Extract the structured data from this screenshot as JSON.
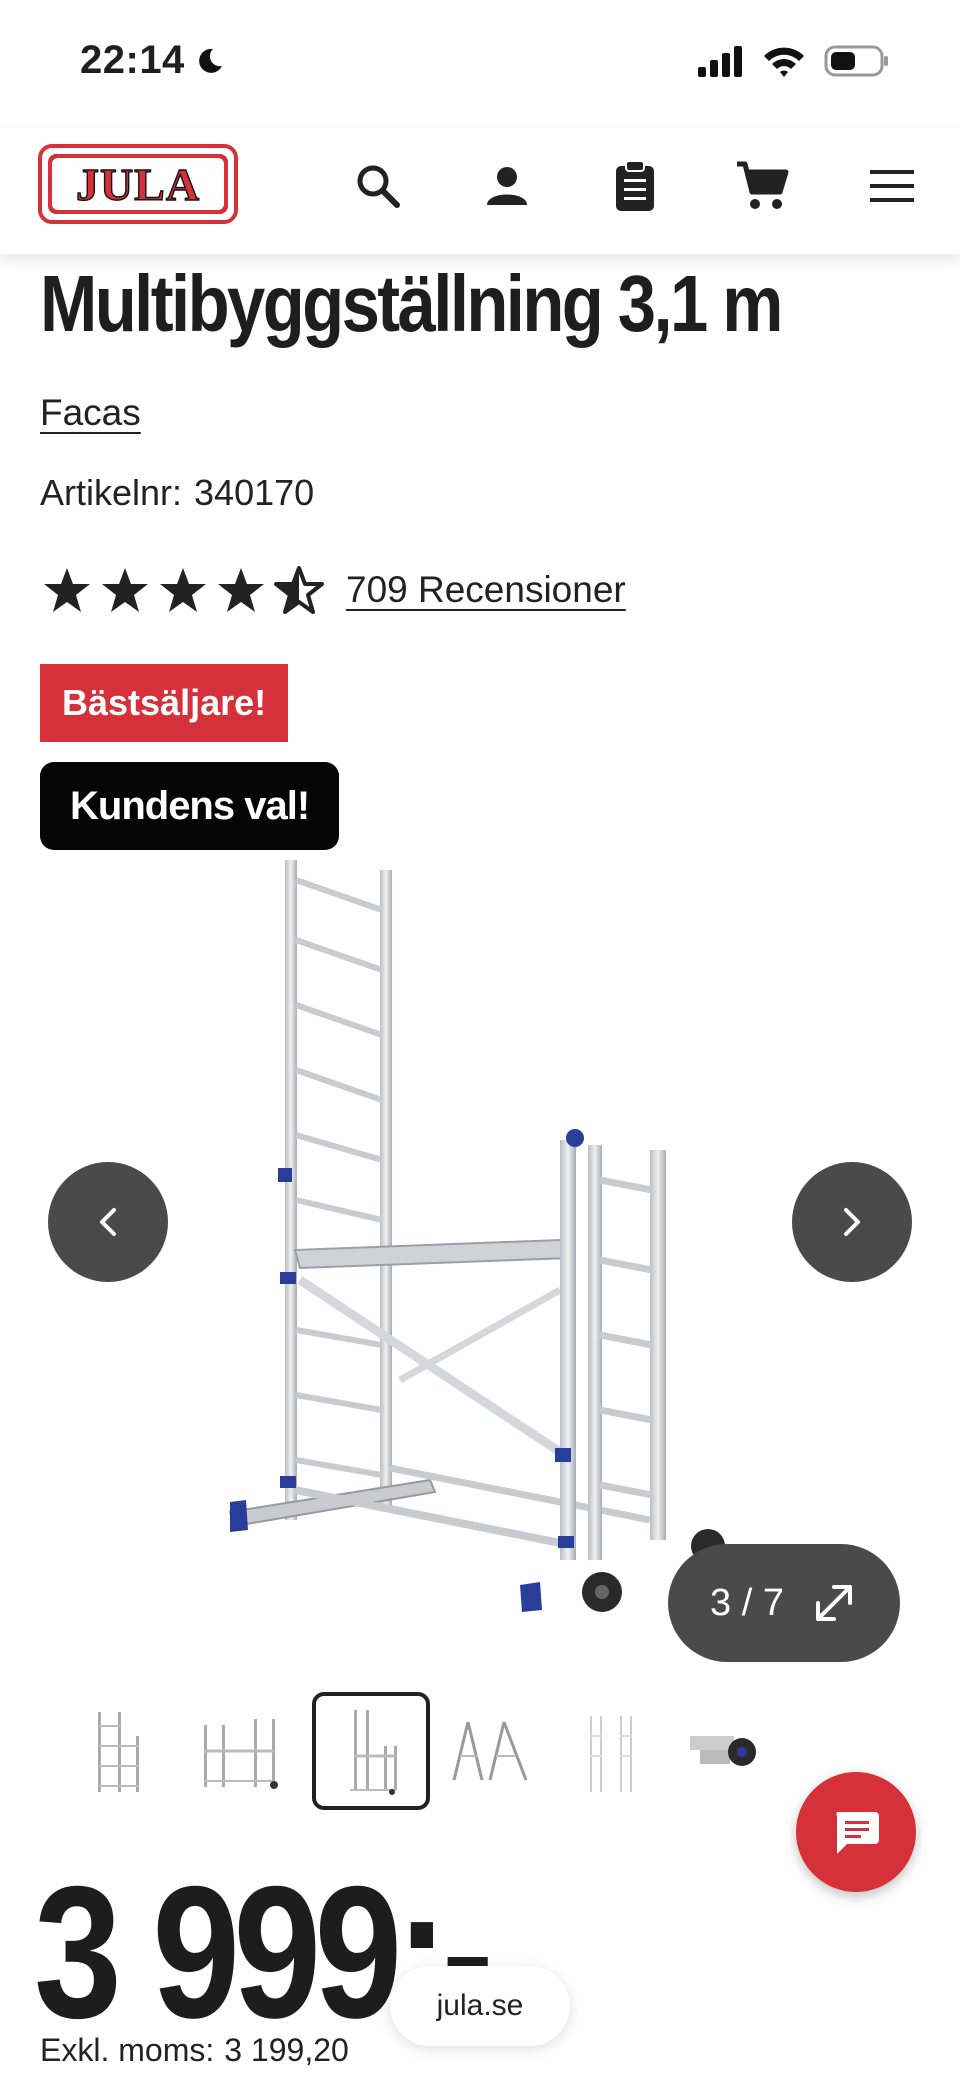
{
  "status_bar": {
    "time": "22:14"
  },
  "header": {
    "logo_text": "JULA",
    "icons": [
      "search-icon",
      "account-icon",
      "clipboard-icon",
      "cart-icon",
      "menu-icon"
    ]
  },
  "product": {
    "title": "Multibyggställning 3,1 m",
    "brand": "Facas",
    "article_label": "Artikelnr:",
    "article_number": "340170",
    "rating": 4.5,
    "reviews_label": "709 Recensioner",
    "badges": {
      "bestseller": "Bästsäljare!",
      "customer_choice": "Kundens val!"
    },
    "gallery": {
      "counter": "3 / 7",
      "active_index": 3,
      "total": 7
    },
    "price": "3 999:-",
    "price_ex_vat_label": "Exkl. moms:",
    "price_ex_vat": "3 199,20"
  },
  "browser": {
    "url": "jula.se"
  },
  "colors": {
    "brand_red": "#d6303b",
    "dark_button": "#4a4a4a"
  }
}
